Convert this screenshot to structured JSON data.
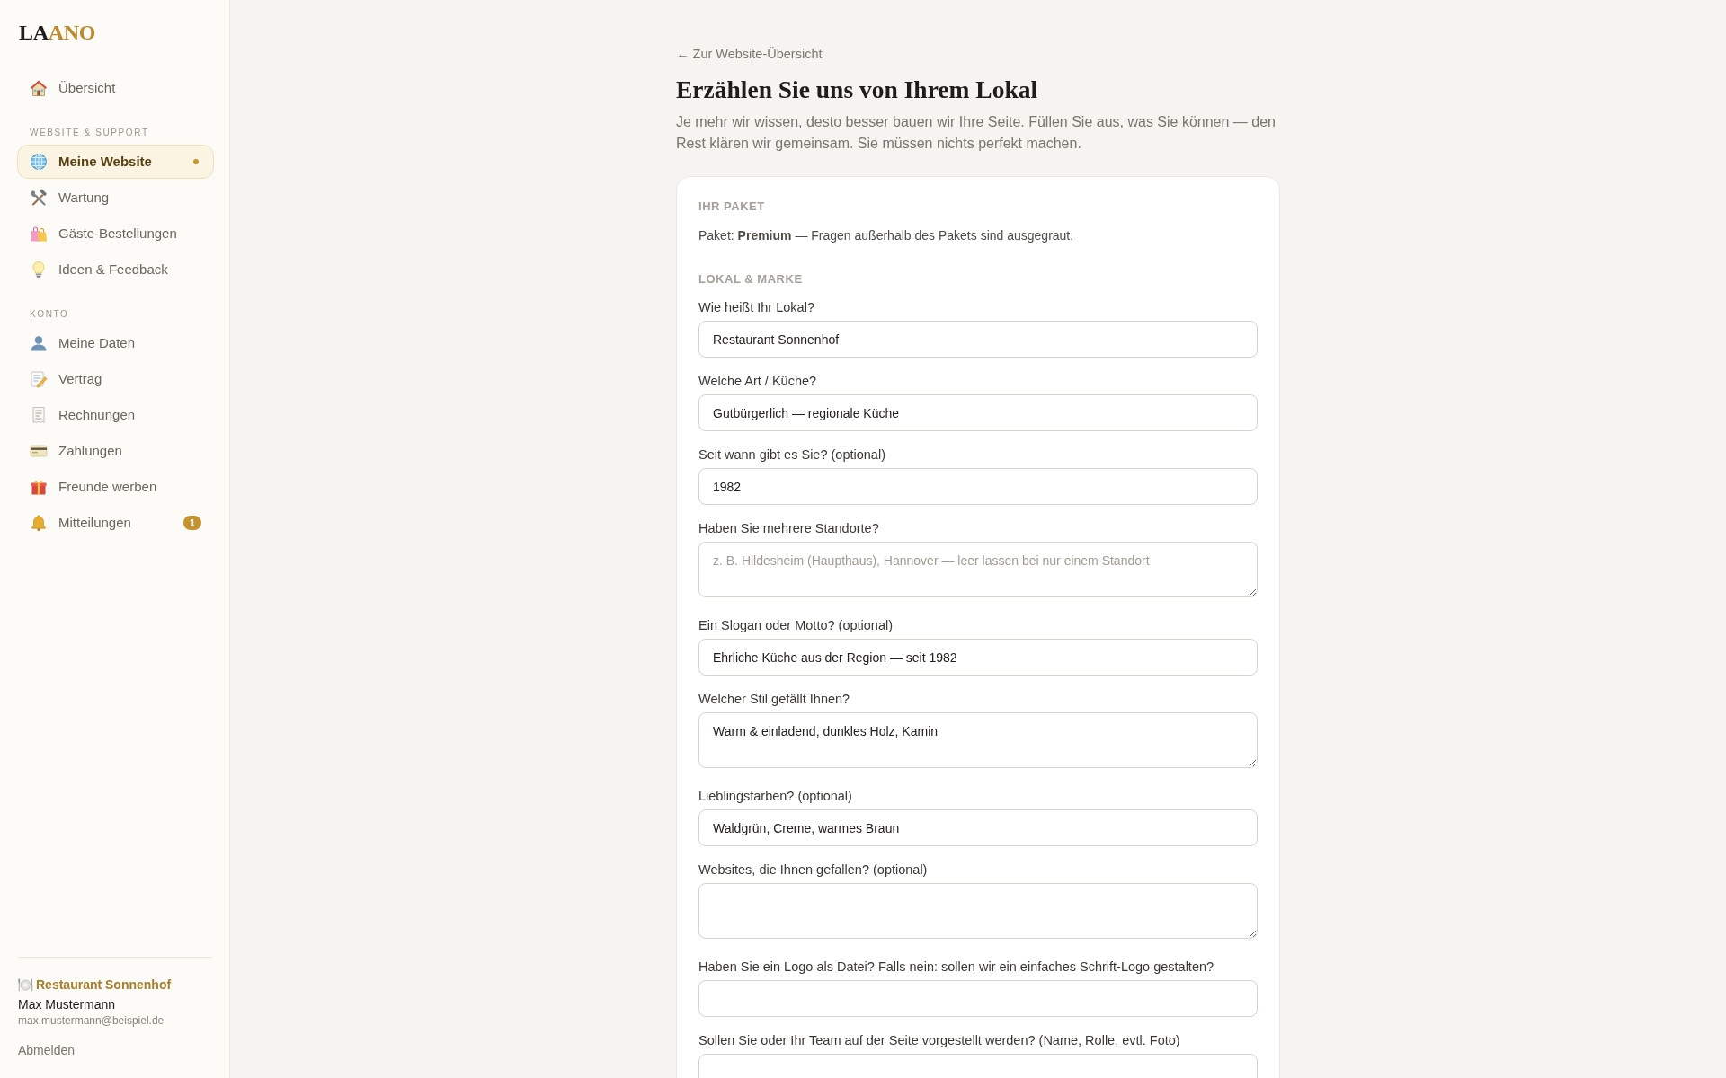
{
  "sidebar": {
    "logo": [
      {
        "text": "LA",
        "accent": false
      },
      {
        "text": "ANO",
        "accent": true
      }
    ],
    "nav_groups": [
      {
        "items": [
          {
            "label": "Übersicht",
            "selected": false
          }
        ]
      },
      {
        "heading": "WEBSITE & SUPPORT",
        "items": [
          {
            "label": "Meine Website",
            "selected": true
          },
          {
            "label": "Wartung",
            "selected": false
          },
          {
            "label": "Gäste-Bestellungen",
            "selected": false
          },
          {
            "label": "Ideen & Feedback",
            "selected": false
          }
        ]
      },
      {
        "heading": "KONTO",
        "items": [
          {
            "label": "Meine Daten",
            "selected": false
          },
          {
            "label": "Vertrag",
            "selected": false
          },
          {
            "label": "Rechnungen",
            "selected": false
          },
          {
            "label": "Zahlungen",
            "selected": false
          },
          {
            "label": "Freunde werben",
            "selected": false
          },
          {
            "label": "Mitteilungen",
            "selected": false,
            "badge": "1"
          }
        ]
      }
    ],
    "account": {
      "restaurant": "Restaurant Sonnenhof",
      "name": "Max Mustermann",
      "email": "max.mustermann@beispiel.de",
      "logout": "Abmelden"
    }
  },
  "main": {
    "back_link": "← Zur Website-Übersicht",
    "title": "Erzählen Sie uns von Ihrem Lokal",
    "intro": "Je mehr wir wissen, desto besser bauen wir Ihre Seite. Füllen Sie aus, was Sie können — den Rest klären wir gemeinsam. Sie müssen nichts perfekt machen.",
    "form": {
      "sections": [
        {
          "heading": "IHR PAKET",
          "text": "Paket: **Premium** — Fragen außerhalb des Pakets sind ausgegraut."
        },
        {
          "heading": "LOKAL & MARKE",
          "fields": [
            {
              "kind": "input",
              "label": "Wie heißt Ihr Lokal?",
              "value": "Restaurant Sonnenhof"
            },
            {
              "kind": "input",
              "label": "Welche Art / Küche?",
              "value": "Gutbürgerlich — regionale Küche"
            },
            {
              "kind": "input",
              "label": "Seit wann gibt es Sie? (optional)",
              "value": "1982"
            },
            {
              "kind": "textarea",
              "label": "Haben Sie mehrere Standorte?",
              "placeholder": "z. B. Hildesheim (Haupthaus), Hannover — leer lassen bei nur einem Standort"
            },
            {
              "kind": "input",
              "label": "Ein Slogan oder Motto? (optional)",
              "value": "Ehrliche Küche aus der Region — seit 1982"
            },
            {
              "kind": "textarea",
              "label": "Welcher Stil gefällt Ihnen?",
              "value": "Warm & einladend, dunkles Holz, Kamin"
            },
            {
              "kind": "input",
              "label": "Lieblingsfarben? (optional)",
              "value": "Waldgrün, Creme, warmes Braun"
            },
            {
              "kind": "textarea",
              "label": "Websites, die Ihnen gefallen? (optional)"
            },
            {
              "kind": "input",
              "label": "Haben Sie ein Logo als Datei? Falls nein: sollen wir ein einfaches Schrift-Logo gestalten?"
            },
            {
              "kind": "input",
              "label": "Sollen Sie oder Ihr Team auf der Seite vorgestellt werden? (Name, Rolle, evtl. Foto)"
            }
          ]
        }
      ]
    }
  }
}
